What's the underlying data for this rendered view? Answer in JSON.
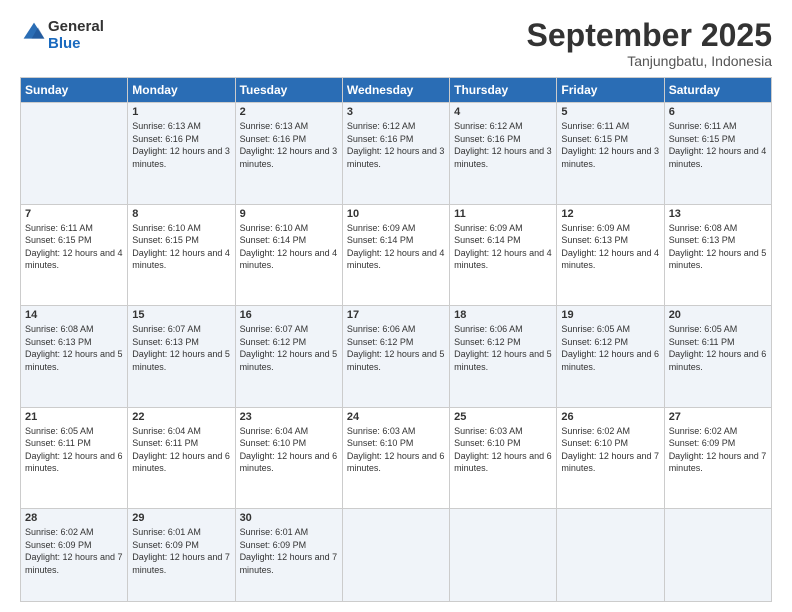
{
  "header": {
    "logo": {
      "line1": "General",
      "line2": "Blue"
    },
    "title": "September 2025",
    "location": "Tanjungbatu, Indonesia"
  },
  "weekdays": [
    "Sunday",
    "Monday",
    "Tuesday",
    "Wednesday",
    "Thursday",
    "Friday",
    "Saturday"
  ],
  "weeks": [
    [
      {
        "day": "",
        "sunrise": "",
        "sunset": "",
        "daylight": ""
      },
      {
        "day": "1",
        "sunrise": "Sunrise: 6:13 AM",
        "sunset": "Sunset: 6:16 PM",
        "daylight": "Daylight: 12 hours and 3 minutes."
      },
      {
        "day": "2",
        "sunrise": "Sunrise: 6:13 AM",
        "sunset": "Sunset: 6:16 PM",
        "daylight": "Daylight: 12 hours and 3 minutes."
      },
      {
        "day": "3",
        "sunrise": "Sunrise: 6:12 AM",
        "sunset": "Sunset: 6:16 PM",
        "daylight": "Daylight: 12 hours and 3 minutes."
      },
      {
        "day": "4",
        "sunrise": "Sunrise: 6:12 AM",
        "sunset": "Sunset: 6:16 PM",
        "daylight": "Daylight: 12 hours and 3 minutes."
      },
      {
        "day": "5",
        "sunrise": "Sunrise: 6:11 AM",
        "sunset": "Sunset: 6:15 PM",
        "daylight": "Daylight: 12 hours and 3 minutes."
      },
      {
        "day": "6",
        "sunrise": "Sunrise: 6:11 AM",
        "sunset": "Sunset: 6:15 PM",
        "daylight": "Daylight: 12 hours and 4 minutes."
      }
    ],
    [
      {
        "day": "7",
        "sunrise": "Sunrise: 6:11 AM",
        "sunset": "Sunset: 6:15 PM",
        "daylight": "Daylight: 12 hours and 4 minutes."
      },
      {
        "day": "8",
        "sunrise": "Sunrise: 6:10 AM",
        "sunset": "Sunset: 6:15 PM",
        "daylight": "Daylight: 12 hours and 4 minutes."
      },
      {
        "day": "9",
        "sunrise": "Sunrise: 6:10 AM",
        "sunset": "Sunset: 6:14 PM",
        "daylight": "Daylight: 12 hours and 4 minutes."
      },
      {
        "day": "10",
        "sunrise": "Sunrise: 6:09 AM",
        "sunset": "Sunset: 6:14 PM",
        "daylight": "Daylight: 12 hours and 4 minutes."
      },
      {
        "day": "11",
        "sunrise": "Sunrise: 6:09 AM",
        "sunset": "Sunset: 6:14 PM",
        "daylight": "Daylight: 12 hours and 4 minutes."
      },
      {
        "day": "12",
        "sunrise": "Sunrise: 6:09 AM",
        "sunset": "Sunset: 6:13 PM",
        "daylight": "Daylight: 12 hours and 4 minutes."
      },
      {
        "day": "13",
        "sunrise": "Sunrise: 6:08 AM",
        "sunset": "Sunset: 6:13 PM",
        "daylight": "Daylight: 12 hours and 5 minutes."
      }
    ],
    [
      {
        "day": "14",
        "sunrise": "Sunrise: 6:08 AM",
        "sunset": "Sunset: 6:13 PM",
        "daylight": "Daylight: 12 hours and 5 minutes."
      },
      {
        "day": "15",
        "sunrise": "Sunrise: 6:07 AM",
        "sunset": "Sunset: 6:13 PM",
        "daylight": "Daylight: 12 hours and 5 minutes."
      },
      {
        "day": "16",
        "sunrise": "Sunrise: 6:07 AM",
        "sunset": "Sunset: 6:12 PM",
        "daylight": "Daylight: 12 hours and 5 minutes."
      },
      {
        "day": "17",
        "sunrise": "Sunrise: 6:06 AM",
        "sunset": "Sunset: 6:12 PM",
        "daylight": "Daylight: 12 hours and 5 minutes."
      },
      {
        "day": "18",
        "sunrise": "Sunrise: 6:06 AM",
        "sunset": "Sunset: 6:12 PM",
        "daylight": "Daylight: 12 hours and 5 minutes."
      },
      {
        "day": "19",
        "sunrise": "Sunrise: 6:05 AM",
        "sunset": "Sunset: 6:12 PM",
        "daylight": "Daylight: 12 hours and 6 minutes."
      },
      {
        "day": "20",
        "sunrise": "Sunrise: 6:05 AM",
        "sunset": "Sunset: 6:11 PM",
        "daylight": "Daylight: 12 hours and 6 minutes."
      }
    ],
    [
      {
        "day": "21",
        "sunrise": "Sunrise: 6:05 AM",
        "sunset": "Sunset: 6:11 PM",
        "daylight": "Daylight: 12 hours and 6 minutes."
      },
      {
        "day": "22",
        "sunrise": "Sunrise: 6:04 AM",
        "sunset": "Sunset: 6:11 PM",
        "daylight": "Daylight: 12 hours and 6 minutes."
      },
      {
        "day": "23",
        "sunrise": "Sunrise: 6:04 AM",
        "sunset": "Sunset: 6:10 PM",
        "daylight": "Daylight: 12 hours and 6 minutes."
      },
      {
        "day": "24",
        "sunrise": "Sunrise: 6:03 AM",
        "sunset": "Sunset: 6:10 PM",
        "daylight": "Daylight: 12 hours and 6 minutes."
      },
      {
        "day": "25",
        "sunrise": "Sunrise: 6:03 AM",
        "sunset": "Sunset: 6:10 PM",
        "daylight": "Daylight: 12 hours and 6 minutes."
      },
      {
        "day": "26",
        "sunrise": "Sunrise: 6:02 AM",
        "sunset": "Sunset: 6:10 PM",
        "daylight": "Daylight: 12 hours and 7 minutes."
      },
      {
        "day": "27",
        "sunrise": "Sunrise: 6:02 AM",
        "sunset": "Sunset: 6:09 PM",
        "daylight": "Daylight: 12 hours and 7 minutes."
      }
    ],
    [
      {
        "day": "28",
        "sunrise": "Sunrise: 6:02 AM",
        "sunset": "Sunset: 6:09 PM",
        "daylight": "Daylight: 12 hours and 7 minutes."
      },
      {
        "day": "29",
        "sunrise": "Sunrise: 6:01 AM",
        "sunset": "Sunset: 6:09 PM",
        "daylight": "Daylight: 12 hours and 7 minutes."
      },
      {
        "day": "30",
        "sunrise": "Sunrise: 6:01 AM",
        "sunset": "Sunset: 6:09 PM",
        "daylight": "Daylight: 12 hours and 7 minutes."
      },
      {
        "day": "",
        "sunrise": "",
        "sunset": "",
        "daylight": ""
      },
      {
        "day": "",
        "sunrise": "",
        "sunset": "",
        "daylight": ""
      },
      {
        "day": "",
        "sunrise": "",
        "sunset": "",
        "daylight": ""
      },
      {
        "day": "",
        "sunrise": "",
        "sunset": "",
        "daylight": ""
      }
    ]
  ]
}
